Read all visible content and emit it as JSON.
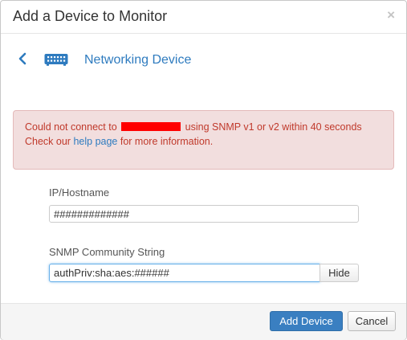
{
  "dialog": {
    "title": "Add a Device to Monitor",
    "close_glyph": "×"
  },
  "device": {
    "back_icon": "chevron-left-icon",
    "type_icon": "network-switch-icon",
    "label": "Networking Device"
  },
  "alert": {
    "line1_prefix": "Could not connect to",
    "line1_suffix": "using SNMP v1 or v2 within 40 seconds",
    "line2_prefix": "Check our",
    "link_text": "help page",
    "line2_suffix": "for more information.",
    "redacted_color": "#ff0000"
  },
  "form": {
    "hostname_label": "IP/Hostname",
    "hostname_value": "#############",
    "community_label": "SNMP Community String",
    "community_value": "authPriv:sha:aes:######",
    "hide_label": "Hide"
  },
  "footer": {
    "add_label": "Add Device",
    "cancel_label": "Cancel"
  },
  "colors": {
    "accent": "#2e7bbf",
    "primary_button": "#3a7fc1",
    "alert_bg": "#f2dede",
    "alert_text": "#c0392b"
  }
}
